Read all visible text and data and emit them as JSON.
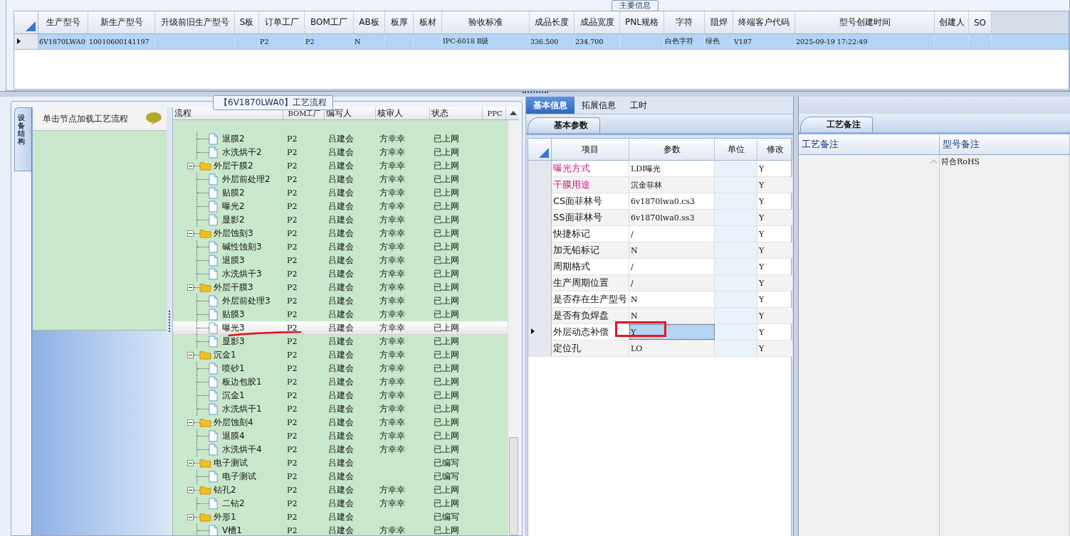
{
  "main_info": {
    "title": "主要信息",
    "columns": [
      "生产型号",
      "新生产型号",
      "升级前旧生产型号",
      "S板",
      "订单工厂",
      "BOM工厂",
      "AB板",
      "板厚",
      "板材",
      "验收标准",
      "成品长度",
      "成品宽度",
      "PNL规格",
      "字符",
      "阻焊",
      "终端客户代码",
      "型号创建时间",
      "创建人",
      "SO"
    ],
    "rows": [
      {
        "selected": true,
        "cells": [
          "6V1870LWA0",
          "10010600141197",
          null,
          null,
          "P2",
          "P2",
          "N",
          null,
          null,
          "IPC-6018 Ⅱ级",
          "336.500",
          "234.700",
          null,
          "白色字符",
          "绿色",
          "V187",
          "2025-09-19 17:22:49",
          null,
          null
        ]
      }
    ]
  },
  "process": {
    "title": "【6V1870LWA0】工艺流程",
    "side_tab": "设备结构",
    "hint": "单击节点加载工艺流程",
    "columns": [
      "流程",
      "BOM工厂",
      "编写人",
      "核审人",
      "状态",
      "PPC"
    ],
    "nodes": [
      {
        "label": "退膜2",
        "bom": "P2",
        "author": "吕建会",
        "reviewer": "方幸幸",
        "status": "已上网",
        "selected": false,
        "underlined": false
      },
      {
        "label": "水洗烘干2",
        "bom": "P2",
        "author": "吕建会",
        "reviewer": "方幸幸",
        "status": "已上网",
        "selected": false,
        "underlined": false
      },
      {
        "label": "外层干膜2",
        "bom": "P2",
        "author": "吕建会",
        "reviewer": "方幸幸",
        "status": "已上网",
        "selected": false,
        "underlined": false,
        "expanded": true,
        "children": [
          {
            "label": "外层前处理2",
            "bom": "P2",
            "author": "吕建会",
            "reviewer": "方幸幸",
            "status": "已上网",
            "selected": false,
            "underlined": false
          },
          {
            "label": "贴膜2",
            "bom": "P2",
            "author": "吕建会",
            "reviewer": "方幸幸",
            "status": "已上网",
            "selected": false,
            "underlined": false
          },
          {
            "label": "曝光2",
            "bom": "P2",
            "author": "吕建会",
            "reviewer": "方幸幸",
            "status": "已上网",
            "selected": false,
            "underlined": false
          },
          {
            "label": "显影2",
            "bom": "P2",
            "author": "吕建会",
            "reviewer": "方幸幸",
            "status": "已上网",
            "selected": false,
            "underlined": false
          }
        ]
      },
      {
        "label": "外层蚀刻3",
        "bom": "P2",
        "author": "吕建会",
        "reviewer": "方幸幸",
        "status": "已上网",
        "selected": false,
        "underlined": false,
        "expanded": true,
        "children": [
          {
            "label": "碱性蚀刻3",
            "bom": "P2",
            "author": "吕建会",
            "reviewer": "方幸幸",
            "status": "已上网",
            "selected": false,
            "underlined": false
          },
          {
            "label": "退膜3",
            "bom": "P2",
            "author": "吕建会",
            "reviewer": "方幸幸",
            "status": "已上网",
            "selected": false,
            "underlined": false
          },
          {
            "label": "水洗烘干3",
            "bom": "P2",
            "author": "吕建会",
            "reviewer": "方幸幸",
            "status": "已上网",
            "selected": false,
            "underlined": false
          }
        ]
      },
      {
        "label": "外层干膜3",
        "bom": "P2",
        "author": "吕建会",
        "reviewer": "方幸幸",
        "status": "已上网",
        "selected": false,
        "underlined": false,
        "expanded": true,
        "children": [
          {
            "label": "外层前处理3",
            "bom": "P2",
            "author": "吕建会",
            "reviewer": "方幸幸",
            "status": "已上网",
            "selected": false,
            "underlined": false
          },
          {
            "label": "贴膜3",
            "bom": "P2",
            "author": "吕建会",
            "reviewer": "方幸幸",
            "status": "已上网",
            "selected": false,
            "underlined": false
          },
          {
            "label": "曝光3",
            "bom": "P2",
            "author": "吕建会",
            "reviewer": "方幸幸",
            "status": "已上网",
            "selected": true,
            "underlined": true
          },
          {
            "label": "显影3",
            "bom": "P2",
            "author": "吕建会",
            "reviewer": "方幸幸",
            "status": "已上网",
            "selected": false,
            "underlined": false
          }
        ]
      },
      {
        "label": "沉金1",
        "bom": "P2",
        "author": "吕建会",
        "reviewer": "方幸幸",
        "status": "已上网",
        "selected": false,
        "underlined": false,
        "expanded": true,
        "children": [
          {
            "label": "喷砂1",
            "bom": "P2",
            "author": "吕建会",
            "reviewer": "方幸幸",
            "status": "已上网",
            "selected": false,
            "underlined": false
          },
          {
            "label": "板边包胶1",
            "bom": "P2",
            "author": "吕建会",
            "reviewer": "方幸幸",
            "status": "已上网",
            "selected": false,
            "underlined": false
          },
          {
            "label": "沉金1",
            "bom": "P2",
            "author": "吕建会",
            "reviewer": "方幸幸",
            "status": "已上网",
            "selected": false,
            "underlined": false
          },
          {
            "label": "水洗烘干1",
            "bom": "P2",
            "author": "吕建会",
            "reviewer": "方幸幸",
            "status": "已上网",
            "selected": false,
            "underlined": false
          }
        ]
      },
      {
        "label": "外层蚀刻4",
        "bom": "P2",
        "author": "吕建会",
        "reviewer": "方幸幸",
        "status": "已上网",
        "selected": false,
        "underlined": false,
        "expanded": true,
        "children": [
          {
            "label": "退膜4",
            "bom": "P2",
            "author": "吕建会",
            "reviewer": "方幸幸",
            "status": "已上网",
            "selected": false,
            "underlined": false
          },
          {
            "label": "水洗烘干4",
            "bom": "P2",
            "author": "吕建会",
            "reviewer": "方幸幸",
            "status": "已上网",
            "selected": false,
            "underlined": false
          }
        ]
      },
      {
        "label": "电子测试",
        "bom": "P2",
        "author": "吕建会",
        "status": "已编写",
        "selected": false,
        "underlined": false,
        "expanded": true,
        "children": [
          {
            "label": "电子测试",
            "bom": "P2",
            "author": "吕建会",
            "status": "已编写",
            "selected": false,
            "underlined": false
          }
        ]
      },
      {
        "label": "钻孔2",
        "bom": "P2",
        "author": "吕建会",
        "reviewer": "方幸幸",
        "status": "已上网",
        "selected": false,
        "underlined": false,
        "expanded": true,
        "children": [
          {
            "label": "二钻2",
            "bom": "P2",
            "author": "吕建会",
            "reviewer": "方幸幸",
            "status": "已上网",
            "selected": false,
            "underlined": false
          }
        ]
      },
      {
        "label": "外形1",
        "bom": "P2",
        "author": "吕建会",
        "status": "已编写",
        "selected": false,
        "underlined": false,
        "expanded": true,
        "children": [
          {
            "label": "V槽1",
            "bom": "P2",
            "author": "吕建会",
            "reviewer": "方幸幸",
            "status": "已上网",
            "selected": false,
            "underlined": false
          }
        ]
      }
    ]
  },
  "details": {
    "tabs": [
      {
        "label": "基本信息",
        "selected": true
      },
      {
        "label": "拓展信息",
        "selected": false
      },
      {
        "label": "工时",
        "selected": false
      }
    ],
    "sub_tab": "基本参数",
    "columns": [
      "项目",
      "参数",
      "单位",
      "修改"
    ],
    "rows": [
      {
        "item": "曝光方式",
        "value": "LDI曝光",
        "edit": "Y",
        "color": "#d0157f",
        "selected": false,
        "boxed": false
      },
      {
        "item": "干膜用途",
        "value": "沉金菲林",
        "edit": "Y",
        "color": "#d0157f",
        "selected": false,
        "boxed": false
      },
      {
        "item": "CS面菲林号",
        "value": "6v1870lwa0.cs3",
        "edit": "Y",
        "selected": false,
        "boxed": false
      },
      {
        "item": "SS面菲林号",
        "value": "6v1870lwa0.ss3",
        "edit": "Y",
        "selected": false,
        "boxed": false
      },
      {
        "item": "快捷标记",
        "value": "/",
        "edit": "Y",
        "selected": false,
        "boxed": false
      },
      {
        "item": "加无铅标记",
        "value": "N",
        "edit": "Y",
        "selected": false,
        "boxed": false
      },
      {
        "item": "周期格式",
        "value": "/",
        "edit": "Y",
        "selected": false,
        "boxed": false
      },
      {
        "item": "生产周期位置",
        "value": "/",
        "edit": "Y",
        "selected": false,
        "boxed": false
      },
      {
        "item": "是否存在生产型号",
        "value": "N",
        "edit": "Y",
        "selected": false,
        "boxed": false
      },
      {
        "item": "是否有负焊盘",
        "value": "N",
        "edit": "Y",
        "selected": false,
        "boxed": false
      },
      {
        "item": "外层动态补偿",
        "value": "Y",
        "edit": "Y",
        "selected": true,
        "boxed": true
      },
      {
        "item": "定位孔",
        "value": "LO",
        "edit": "Y",
        "selected": false,
        "boxed": false
      }
    ]
  },
  "remarks": {
    "tab": "工艺备注",
    "columns": [
      "工艺备注",
      "型号备注"
    ],
    "model_remark": "符合RoHS"
  }
}
